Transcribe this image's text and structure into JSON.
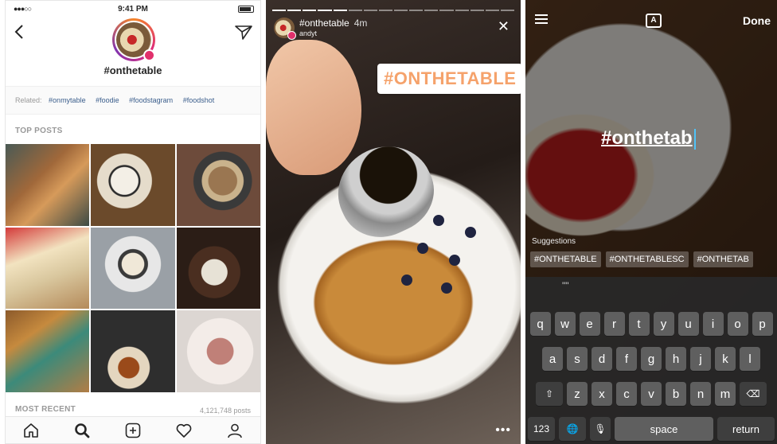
{
  "screen1": {
    "status": {
      "signal": "●●●○○",
      "time": "9:41 PM"
    },
    "hashtag": "#onthetable",
    "related": {
      "label": "Related:",
      "tags": [
        "#onmytable",
        "#foodie",
        "#foodstagram",
        "#foodshot"
      ]
    },
    "top_posts_label": "TOP POSTS",
    "most_recent_label": "MOST RECENT",
    "post_count": "4,121,748 posts",
    "icons": [
      "back-icon",
      "direct-send-icon",
      "home-icon",
      "search-icon",
      "add-post-icon",
      "heart-icon",
      "profile-icon"
    ]
  },
  "screen2": {
    "username": "#onthetable",
    "age": "4m",
    "subtitle": "andyt",
    "sticker": "#ONTHETABLE",
    "close": "✕",
    "more": "•••"
  },
  "screen3": {
    "font_button": "A",
    "done": "Done",
    "typed_text": "#onthetab",
    "suggestions_label": "Suggestions",
    "suggestions": [
      "#ONTHETABLE",
      "#ONTHETABLESC",
      "#ONTHETAB"
    ],
    "keyboard": {
      "predict": "\"\"",
      "row1": [
        "q",
        "w",
        "e",
        "r",
        "t",
        "y",
        "u",
        "i",
        "o",
        "p"
      ],
      "row2": [
        "a",
        "s",
        "d",
        "f",
        "g",
        "h",
        "j",
        "k",
        "l"
      ],
      "row3": [
        "z",
        "x",
        "c",
        "v",
        "b",
        "n",
        "m"
      ],
      "shift": "⇧",
      "backspace": "⌫",
      "numbers": "123",
      "globe": "🌐",
      "mic": "🎙",
      "space": "space",
      "return": "return"
    }
  }
}
